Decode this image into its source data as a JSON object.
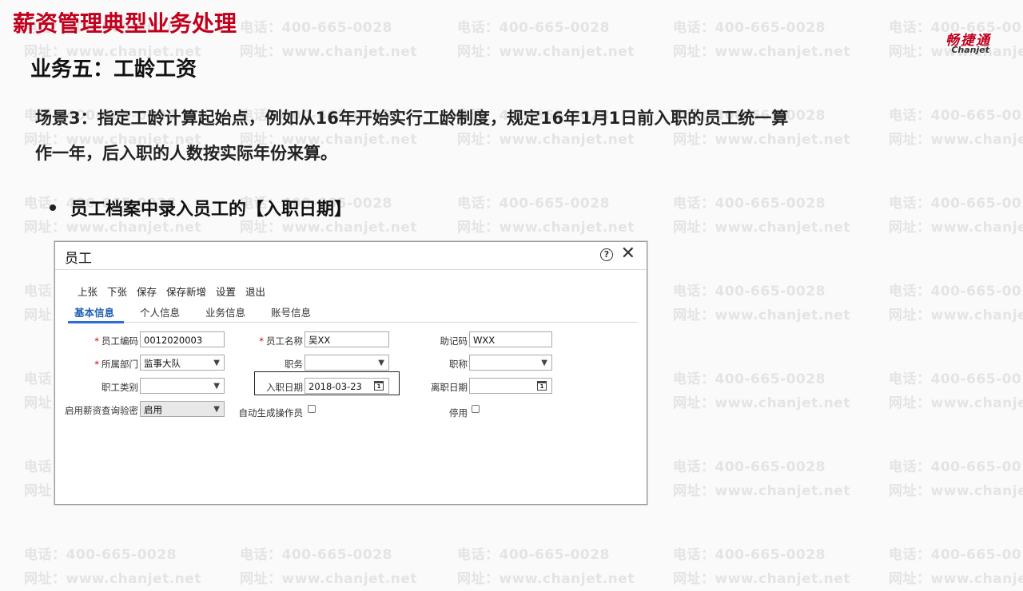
{
  "slide": {
    "title": "薪资管理典型业务处理",
    "subtitle": "业务五：工龄工资",
    "scene_line1": "场景3：指定工龄计算起始点，例如从16年开始实行工龄制度，规定16年1月1日前入职的员工统一算",
    "scene_line2": "作一年，后入职的人数按实际年份来算。",
    "bullet": "员工档案中录入员工的【入职日期】"
  },
  "logo": {
    "cn": "畅捷通",
    "en": "Chanjet"
  },
  "watermark": {
    "phone": "电话：400-665-0028",
    "site": "网址：www.chanjet.net",
    "color": "#e4e4e4"
  },
  "dialog": {
    "title": "员工",
    "help_icon": "help-circle-icon",
    "close_icon": "close-icon",
    "toolbar": [
      "上张",
      "下张",
      "保存",
      "保存新增",
      "设置",
      "退出"
    ],
    "tabs": [
      "基本信息",
      "个人信息",
      "业务信息",
      "账号信息"
    ],
    "active_tab": "基本信息",
    "fields": {
      "emp_code": {
        "label": "员工编码",
        "value": "0012020003"
      },
      "emp_name": {
        "label": "员工名称",
        "value": "吴XX"
      },
      "memo_code": {
        "label": "助记码",
        "value": "WXX"
      },
      "dept": {
        "label": "所属部门",
        "value": "监事大队"
      },
      "duty": {
        "label": "职务",
        "value": ""
      },
      "title": {
        "label": "职称",
        "value": ""
      },
      "category": {
        "label": "职工类别",
        "value": ""
      },
      "hire_date": {
        "label": "入职日期",
        "value": "2018-03-23"
      },
      "leave_date": {
        "label": "离职日期",
        "value": ""
      },
      "salary_pwd": {
        "label": "启用薪资查询验密",
        "value": "启用"
      },
      "auto_operator": {
        "label": "自动生成操作员"
      },
      "disabled": {
        "label": "停用"
      }
    }
  },
  "colors": {
    "title_red": "#c0001d",
    "tab_blue": "#1e5fb3",
    "required": "#d40000"
  }
}
